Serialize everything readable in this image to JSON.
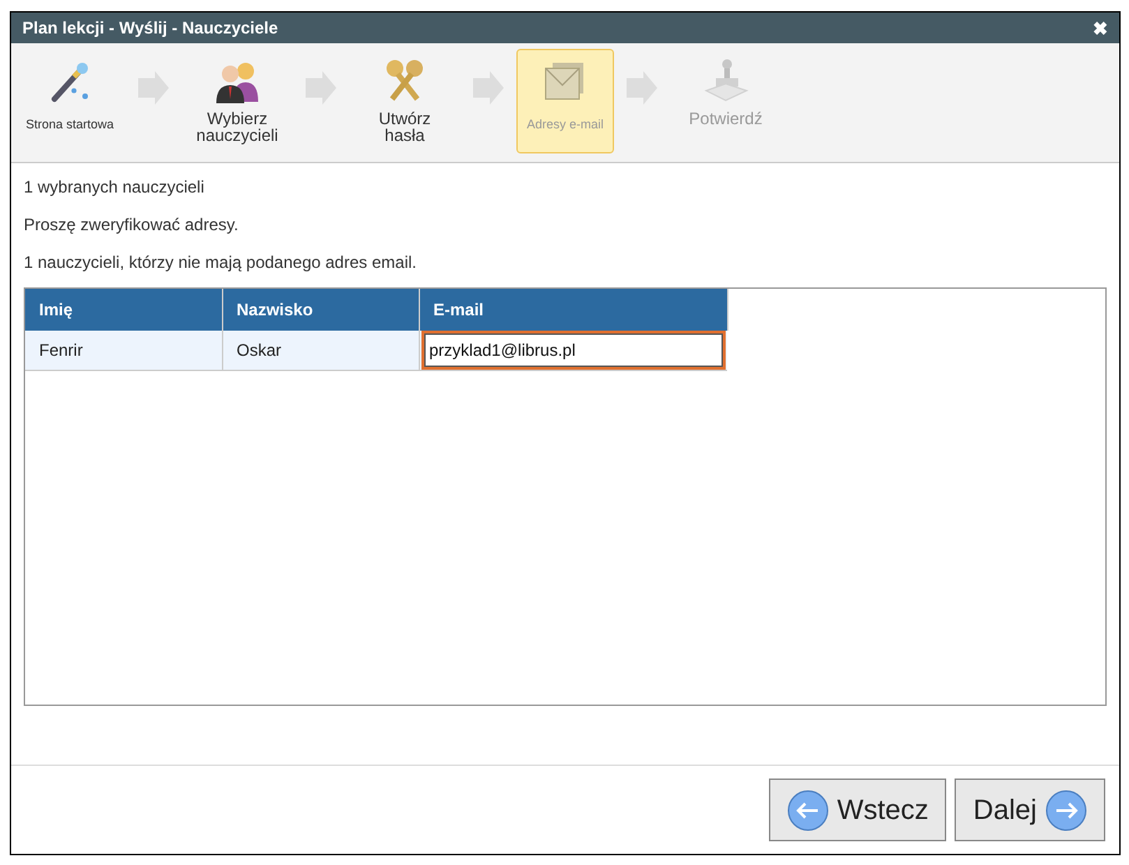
{
  "window": {
    "title": "Plan lekcji - Wyślij - Nauczyciele",
    "close": "✖"
  },
  "steps": [
    {
      "label": "Strona startowa",
      "kind": "wand",
      "selected": false,
      "disabled": false,
      "compact": true
    },
    {
      "label": "Wybierz nauczycieli",
      "kind": "people",
      "selected": false,
      "disabled": false,
      "compact": false
    },
    {
      "label": "Utwórz hasła",
      "kind": "keys",
      "selected": false,
      "disabled": false,
      "compact": false
    },
    {
      "label": "Adresy e-mail",
      "kind": "envelopes",
      "selected": true,
      "disabled": false,
      "compact": true
    },
    {
      "label": "Potwierdź",
      "kind": "stamp",
      "selected": false,
      "disabled": true,
      "compact": false
    }
  ],
  "messages": [
    "1 wybranych nauczycieli",
    "Proszę zweryfikować adresy.",
    "1 nauczycieli, którzy nie mają podanego adres email."
  ],
  "table": {
    "columns": [
      "Imię",
      "Nazwisko",
      "E-mail"
    ],
    "rows": [
      {
        "first_name": "Fenrir",
        "last_name": "Oskar",
        "email": "przyklad1@librus.pl",
        "email_focused": true
      }
    ]
  },
  "buttons": [
    {
      "label": "Wstecz",
      "kind": "back"
    },
    {
      "label": "Dalej",
      "kind": "next"
    }
  ]
}
